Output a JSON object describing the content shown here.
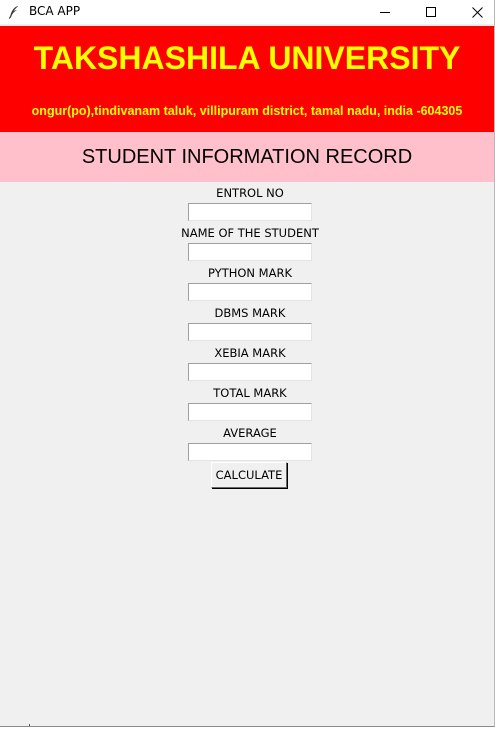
{
  "window": {
    "title": "BCA APP",
    "icon": "feather-icon"
  },
  "header": {
    "university": "TAKSHASHILA UNIVERSITY",
    "address": "ongur(po),tindivanam taluk, villipuram district, tamal nadu, india -604305",
    "background": "#ff0000",
    "text_color": "#ffff00"
  },
  "banner": {
    "title": "STUDENT INFORMATION RECORD",
    "background": "#ffc0cb"
  },
  "form": {
    "fields": [
      {
        "label": "ENTROL NO",
        "value": ""
      },
      {
        "label": "NAME OF THE STUDENT",
        "value": ""
      },
      {
        "label": "PYTHON MARK",
        "value": ""
      },
      {
        "label": "DBMS MARK",
        "value": ""
      },
      {
        "label": "XEBIA MARK",
        "value": ""
      },
      {
        "label": "TOTAL MARK",
        "value": ""
      },
      {
        "label": "AVERAGE",
        "value": ""
      }
    ],
    "calculate_label": "CALCULATE"
  }
}
